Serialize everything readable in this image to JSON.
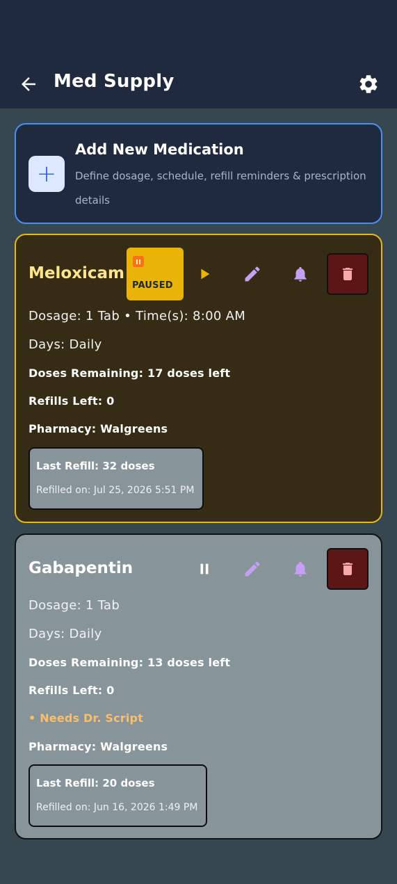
{
  "header": {
    "title": "Med Supply",
    "back_icon": "arrow-left-icon",
    "settings_icon": "gear-icon"
  },
  "add_card": {
    "icon": "plus-icon",
    "title": "Add New Medication",
    "description": "Define dosage, schedule, refill reminders & prescription details"
  },
  "medications": [
    {
      "name": "Meloxicam",
      "status_badge": "PAUSED",
      "status_icon": "pause-icon",
      "toggle_icon": "play-icon",
      "dosage_line": "Dosage: 1 Tab • Time(s): 8:00 AM",
      "days_line": "Days: Daily",
      "doses_line": "Doses Remaining: 17 doses left",
      "refills_line": "Refills Left: 0",
      "pharmacy_line": "Pharmacy: Walgreens",
      "last_refill": "Last Refill: 32 doses",
      "refilled_on": "Refilled on: Jul 25, 2026 5:51 PM"
    },
    {
      "name": "Gabapentin",
      "toggle_icon": "pause-icon",
      "dosage_line": "Dosage: 1 Tab",
      "days_line": "Days: Daily",
      "doses_line": "Doses Remaining: 13 doses left",
      "refills_line": "Refills Left: 0",
      "warning_line": "• Needs Dr. Script",
      "pharmacy_line": "Pharmacy: Walgreens",
      "last_refill": "Last Refill: 20 doses",
      "refilled_on": "Refilled on: Jun 16, 2026 1:49 PM"
    }
  ],
  "colors": {
    "header_bg": "#1f2a3e",
    "page_bg": "#37474f",
    "accent_blue": "#4c8ef7",
    "paused_border": "#e8b81a",
    "paused_badge": "#eab308",
    "delete_bg": "#5c1616",
    "warning_text": "#fbbf6b",
    "edit_icon": "#c4a1f5"
  }
}
